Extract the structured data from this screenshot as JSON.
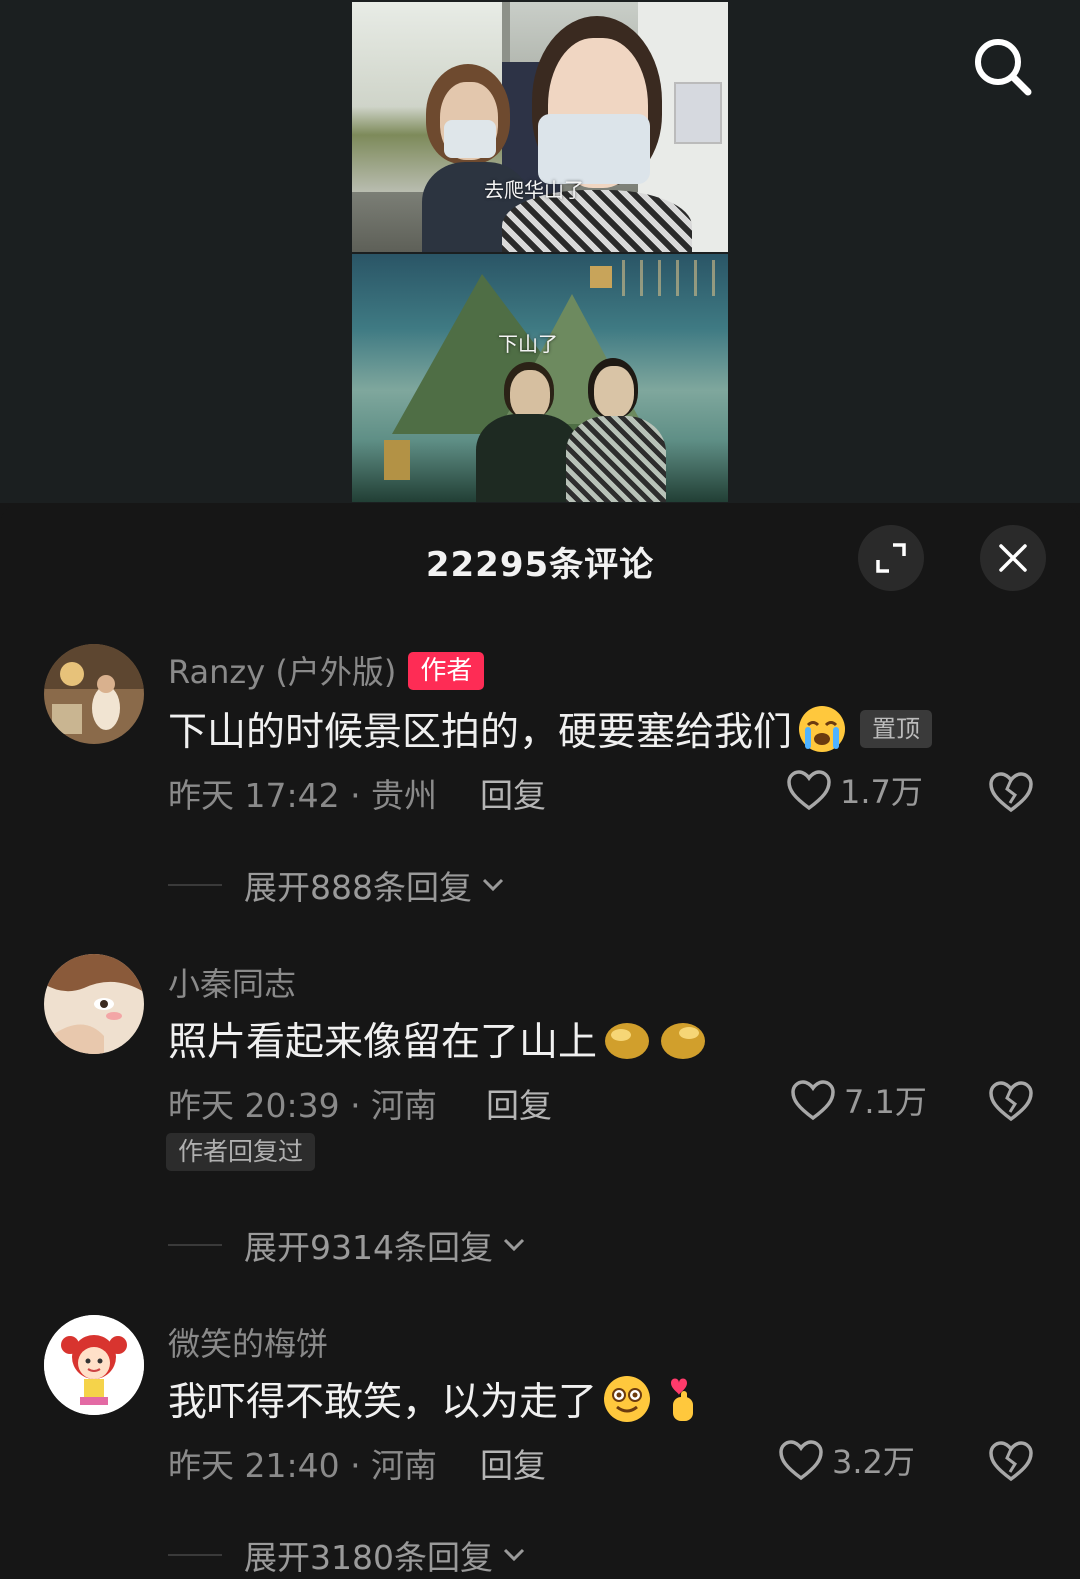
{
  "video": {
    "caption_top": "去爬华山了",
    "caption_bottom": "下山了"
  },
  "panel": {
    "title": "22295条评论"
  },
  "comments": [
    {
      "username": "Ranzy (户外版)",
      "author_tag": "作者",
      "text": "下山的时候景区拍的，硬要塞给我们",
      "emojis": [
        "crying-emoji"
      ],
      "pin_tag": "置顶",
      "meta": "昨天 17:42 · 贵州",
      "reply_label": "回复",
      "likes": "1.7万",
      "expand_label": "展开888条回复"
    },
    {
      "username": "小秦同志",
      "text": "照片看起来像留在了山上",
      "emojis": [
        "blurred-emoji",
        "blurred-emoji"
      ],
      "meta": "昨天 20:39 · 河南",
      "reply_label": "回复",
      "likes": "7.1万",
      "replied_tag": "作者回复过",
      "expand_label": "展开9314条回复"
    },
    {
      "username": "微笑的梅饼",
      "text": "我吓得不敢笑，以为走了",
      "emojis": [
        "flushed-smile-emoji",
        "finger-heart-emoji"
      ],
      "meta": "昨天 21:40 · 河南",
      "reply_label": "回复",
      "likes": "3.2万",
      "expand_label": "展开3180条回复"
    }
  ],
  "colors": {
    "accent": "#fe2c55",
    "background": "#161616",
    "muted_text": "#8a8a8a"
  }
}
